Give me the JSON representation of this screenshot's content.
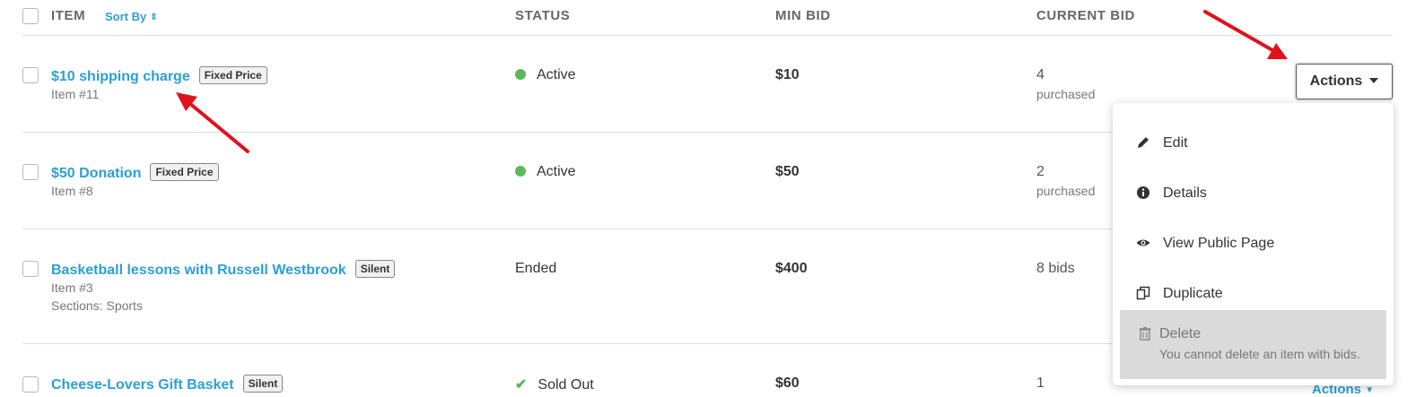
{
  "header": {
    "item": "ITEM",
    "sort_by": "Sort By",
    "status": "STATUS",
    "min_bid": "MIN BID",
    "current_bid": "CURRENT BID"
  },
  "rows": [
    {
      "title": "$10 shipping charge",
      "badge": "Fixed Price",
      "sub1": "Item #11",
      "sub2": "",
      "status": "Active",
      "min_bid": "$10",
      "current": "4",
      "current_sub": "purchased"
    },
    {
      "title": "$50 Donation",
      "badge": "Fixed Price",
      "sub1": "Item #8",
      "sub2": "",
      "status": "Active",
      "min_bid": "$50",
      "current": "2",
      "current_sub": "purchased"
    },
    {
      "title": "Basketball lessons with Russell Westbrook",
      "badge": "Silent",
      "sub1": "Item #3",
      "sub2": "Sections: Sports",
      "status": "Ended",
      "min_bid": "$400",
      "current": "8 bids",
      "current_sub": ""
    },
    {
      "title": "Cheese-Lovers Gift Basket",
      "badge": "Silent",
      "sub1": "",
      "sub2": "",
      "status": "Sold Out",
      "min_bid": "$60",
      "current": "1",
      "current_sub": ""
    }
  ],
  "actions": {
    "button_label": "Actions",
    "link_label": "Actions"
  },
  "menu": {
    "edit": "Edit",
    "details": "Details",
    "view_public_page": "View Public Page",
    "duplicate": "Duplicate",
    "delete": "Delete",
    "delete_note": "You cannot delete an item with bids."
  },
  "colors": {
    "link": "#2c9fd6",
    "active_status": "#5cb85c",
    "annotation_arrow": "#e0121b"
  }
}
